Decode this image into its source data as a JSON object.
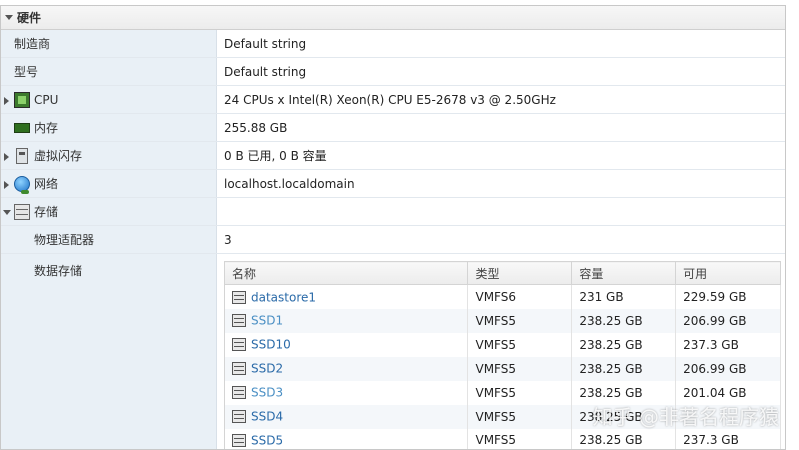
{
  "section": {
    "title": "硬件"
  },
  "rows": {
    "manufacturer": {
      "label": "制造商",
      "value": "Default string"
    },
    "model": {
      "label": "型号",
      "value": "Default string"
    },
    "cpu": {
      "label": "CPU",
      "value": "24 CPUs x Intel(R) Xeon(R) CPU E5-2678 v3 @ 2.50GHz",
      "icon": "cpu-icon"
    },
    "memory": {
      "label": "内存",
      "value": "255.88 GB",
      "icon": "memory-icon"
    },
    "flash": {
      "label": "虚拟闪存",
      "value": "0 B 已用, 0 B 容量",
      "icon": "flash-icon"
    },
    "network": {
      "label": "网络",
      "value": "localhost.localdomain",
      "icon": "network-icon"
    },
    "storage": {
      "label": "存储",
      "value": "",
      "icon": "storage-icon"
    },
    "adapters": {
      "label": "物理适配器",
      "value": "3"
    },
    "datastores": {
      "label": "数据存储"
    }
  },
  "datastore_table": {
    "columns": [
      "名称",
      "类型",
      "容量",
      "可用"
    ],
    "rows": [
      {
        "name": "datastore1",
        "type": "VMFS6",
        "capacity": "231 GB",
        "free": "229.59 GB"
      },
      {
        "name": "SSD1",
        "type": "VMFS5",
        "capacity": "238.25 GB",
        "free": "206.99 GB"
      },
      {
        "name": "SSD10",
        "type": "VMFS5",
        "capacity": "238.25 GB",
        "free": "237.3 GB"
      },
      {
        "name": "SSD2",
        "type": "VMFS5",
        "capacity": "238.25 GB",
        "free": "206.99 GB"
      },
      {
        "name": "SSD3",
        "type": "VMFS5",
        "capacity": "238.25 GB",
        "free": "201.04 GB"
      },
      {
        "name": "SSD4",
        "type": "VMFS5",
        "capacity": "238.25 GB",
        "free": ""
      },
      {
        "name": "SSD5",
        "type": "VMFS5",
        "capacity": "238.25 GB",
        "free": "237.3 GB"
      }
    ]
  },
  "watermark": "知乎 @非著名程序猿",
  "colors": {
    "label_bg": "#e9f0f6",
    "link": "#2a6aa8"
  }
}
